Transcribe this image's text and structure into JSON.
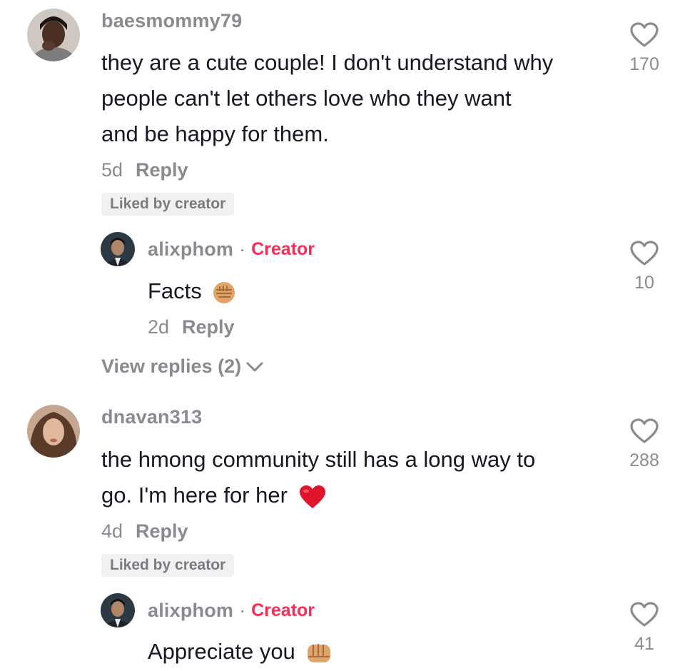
{
  "comments": [
    {
      "username": "baesmommy79",
      "text_lines": [
        "they are a cute couple! I don't understand why",
        "people can't let others love who they want",
        "and be happy for them."
      ],
      "age": "5d",
      "reply_label": "Reply",
      "likes": "170",
      "liked_badge": "Liked by creator",
      "reply": {
        "username": "alixphom",
        "separator": "·",
        "creator_tag": "Creator",
        "text": "Facts",
        "emoji_icon": "raised-fist-icon",
        "age": "2d",
        "reply_label": "Reply",
        "likes": "10"
      },
      "view_replies": "View replies (2)"
    },
    {
      "username": "dnavan313",
      "text_lines": [
        "the hmong community still has a long way to",
        "go. I'm here for her"
      ],
      "emoji_icon": "red-heart-icon",
      "age": "4d",
      "reply_label": "Reply",
      "likes": "288",
      "liked_badge": "Liked by creator",
      "reply": {
        "username": "alixphom",
        "separator": "·",
        "creator_tag": "Creator",
        "text": "Appreciate you",
        "emoji_icon": "oncoming-fist-icon",
        "likes": "41"
      }
    }
  ],
  "colors": {
    "accent": "#fe2c55",
    "muted": "#8a8b91",
    "text": "#161823",
    "badge_bg": "#f1f1f2"
  }
}
